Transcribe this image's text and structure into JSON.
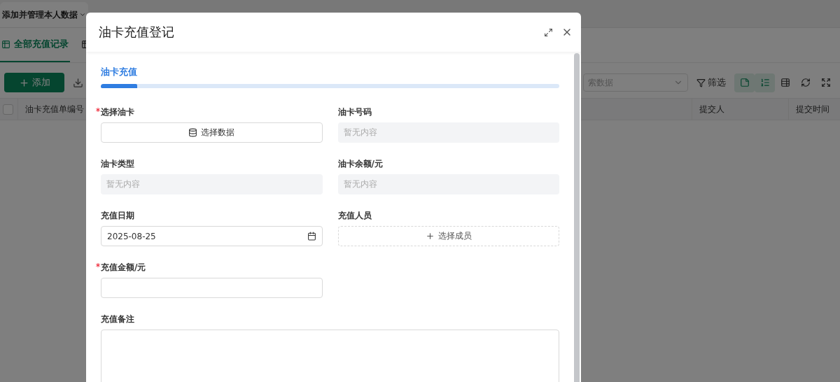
{
  "page": {
    "header_tab": {
      "label": "添加并管理本人数据"
    },
    "tabs": [
      {
        "label": "全部充值记录",
        "selected": true
      },
      {
        "selected": false
      }
    ],
    "toolbar": {
      "add_button": "添加",
      "search": {
        "placeholder": "索数据"
      },
      "filter_button": "筛选",
      "tools": [
        {
          "kind": "note",
          "active": true
        },
        {
          "kind": "sort",
          "active": true
        },
        {
          "kind": "columns",
          "active": false
        },
        {
          "kind": "refresh",
          "active": false
        },
        {
          "kind": "fullscreen",
          "active": false
        }
      ]
    },
    "table": {
      "select_all_checked": false,
      "columns_left": [
        "油卡充值单编号"
      ],
      "columns_right": [
        "提交人",
        "提交时间"
      ]
    }
  },
  "dialog": {
    "title": "油卡充值登记",
    "tabs": [
      {
        "label": "油卡充值",
        "selected": true
      }
    ],
    "fields": [
      {
        "kind": "picker",
        "label": "选择油卡",
        "required": true,
        "text": "选择数据"
      },
      {
        "kind": "readonly",
        "label": "油卡号码",
        "required": false,
        "placeholder": "暂无内容"
      },
      {
        "kind": "readonly",
        "label": "油卡类型",
        "required": false,
        "placeholder": "暂无内容"
      },
      {
        "kind": "readonly",
        "label": "油卡余额/元",
        "required": false,
        "placeholder": "暂无内容"
      },
      {
        "kind": "date",
        "label": "充值日期",
        "required": false,
        "value": "2025-08-25"
      },
      {
        "kind": "member",
        "label": "充值人员",
        "required": false,
        "text": "选择成员"
      },
      {
        "kind": "input",
        "label": "充值金额/元",
        "required": true
      },
      {
        "kind": "spacer"
      },
      {
        "kind": "textarea",
        "label": "充值备注",
        "required": false
      }
    ]
  }
}
